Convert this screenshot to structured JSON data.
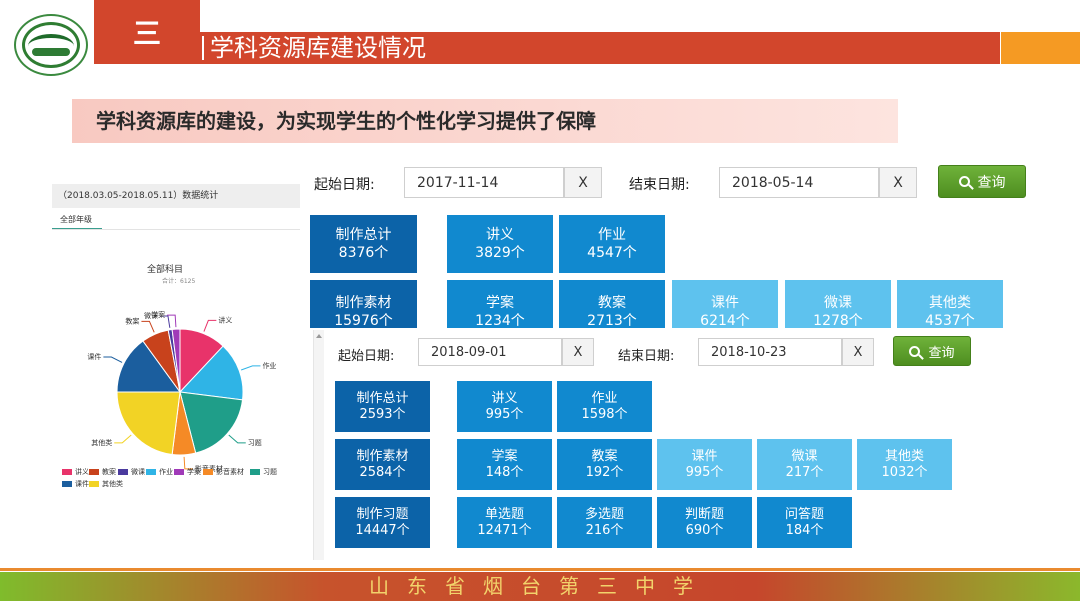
{
  "header": {
    "section_number": "三",
    "title": "学科资源库建设情况",
    "subtitle": "学科资源库的建设，为实现学生的个性化学习提供了保障"
  },
  "left_panel": {
    "header": "（2018.03.05-2018.05.11）数据统计",
    "tab": "全部年级",
    "chart_title": "全部科目",
    "chart_subtitle": "合计：6125"
  },
  "panel1": {
    "start_label": "起始日期:",
    "start_value": "2017-11-14",
    "clear_label": "X",
    "end_label": "结束日期:",
    "end_value": "2018-05-14",
    "query_label": "查询",
    "tiles": [
      {
        "name": "制作总计",
        "value": "8376个"
      },
      {
        "name": "讲义",
        "value": "3829个"
      },
      {
        "name": "作业",
        "value": "4547个"
      },
      {
        "name": "制作素材",
        "value": "15976个"
      },
      {
        "name": "学案",
        "value": "1234个"
      },
      {
        "name": "教案",
        "value": "2713个"
      },
      {
        "name": "课件",
        "value": "6214个"
      },
      {
        "name": "微课",
        "value": "1278个"
      },
      {
        "name": "其他类",
        "value": "4537个"
      }
    ]
  },
  "panel2": {
    "start_label": "起始日期:",
    "start_value": "2018-09-01",
    "clear_label": "X",
    "end_label": "结束日期:",
    "end_value": "2018-10-23",
    "query_label": "查询",
    "tiles": [
      {
        "name": "制作总计",
        "value": "2593个"
      },
      {
        "name": "讲义",
        "value": "995个"
      },
      {
        "name": "作业",
        "value": "1598个"
      },
      {
        "name": "制作素材",
        "value": "2584个"
      },
      {
        "name": "学案",
        "value": "148个"
      },
      {
        "name": "教案",
        "value": "192个"
      },
      {
        "name": "课件",
        "value": "995个"
      },
      {
        "name": "微课",
        "value": "217个"
      },
      {
        "name": "其他类",
        "value": "1032个"
      },
      {
        "name": "制作习题",
        "value": "14447个"
      },
      {
        "name": "单选题",
        "value": "12471个"
      },
      {
        "name": "多选题",
        "value": "216个"
      },
      {
        "name": "判断题",
        "value": "690个"
      },
      {
        "name": "问答题",
        "value": "184个"
      }
    ]
  },
  "chart_data": {
    "type": "pie",
    "title": "全部科目",
    "subtitle": "合计：6125",
    "legend_position": "bottom",
    "slices": [
      {
        "label": "讲义",
        "value": 12,
        "color": "#e8336a"
      },
      {
        "label": "作业",
        "value": 15,
        "color": "#2fb4e6"
      },
      {
        "label": "习题",
        "value": 19,
        "color": "#1f9e89"
      },
      {
        "label": "影音素材",
        "value": 6,
        "color": "#f58a26"
      },
      {
        "label": "其他类",
        "value": 23,
        "color": "#f2d325"
      },
      {
        "label": "课件",
        "value": 15,
        "color": "#1b5e9e"
      },
      {
        "label": "教案",
        "value": 7,
        "color": "#c8421c"
      },
      {
        "label": "微课",
        "value": 1,
        "color": "#4a3a9e"
      },
      {
        "label": "学案",
        "value": 2,
        "color": "#a03ab8"
      }
    ],
    "legend": [
      "讲义",
      "教案",
      "微课",
      "作业",
      "学案",
      "影音素材",
      "习题",
      "课件",
      "其他类"
    ]
  },
  "footer": {
    "school": "山东省烟台第三中学"
  }
}
